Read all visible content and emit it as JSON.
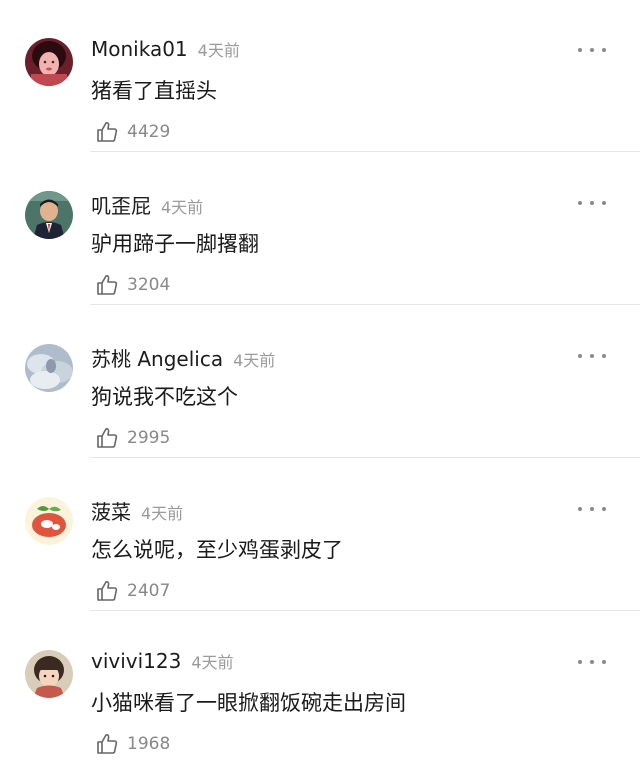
{
  "comments": [
    {
      "username": "Monika01",
      "time": "4天前",
      "text": "猪看了直摇头",
      "likes": "4429",
      "avatar": "girl-avatar"
    },
    {
      "username": "叽歪屁",
      "time": "4天前",
      "text": "驴用蹄子一脚撂翻",
      "likes": "3204",
      "avatar": "man-avatar"
    },
    {
      "username": "苏桃 Angelica",
      "time": "4天前",
      "text": "狗说我不吃这个",
      "likes": "2995",
      "avatar": "clouds-avatar"
    },
    {
      "username": "菠菜",
      "time": "4天前",
      "text": "怎么说呢，至少鸡蛋剥皮了",
      "likes": "2407",
      "avatar": "food-avatar"
    },
    {
      "username": "vivivi123",
      "time": "4天前",
      "text": "小猫咪看了一眼掀翻饭碗走出房间",
      "likes": "1968",
      "avatar": "anime-avatar"
    }
  ],
  "icons": {
    "like": "thumbs-up-icon",
    "more": "more-icon"
  },
  "colors": {
    "username": "#1c1c1c",
    "meta": "#9a9a9a",
    "divider": "#e6e6e6"
  }
}
